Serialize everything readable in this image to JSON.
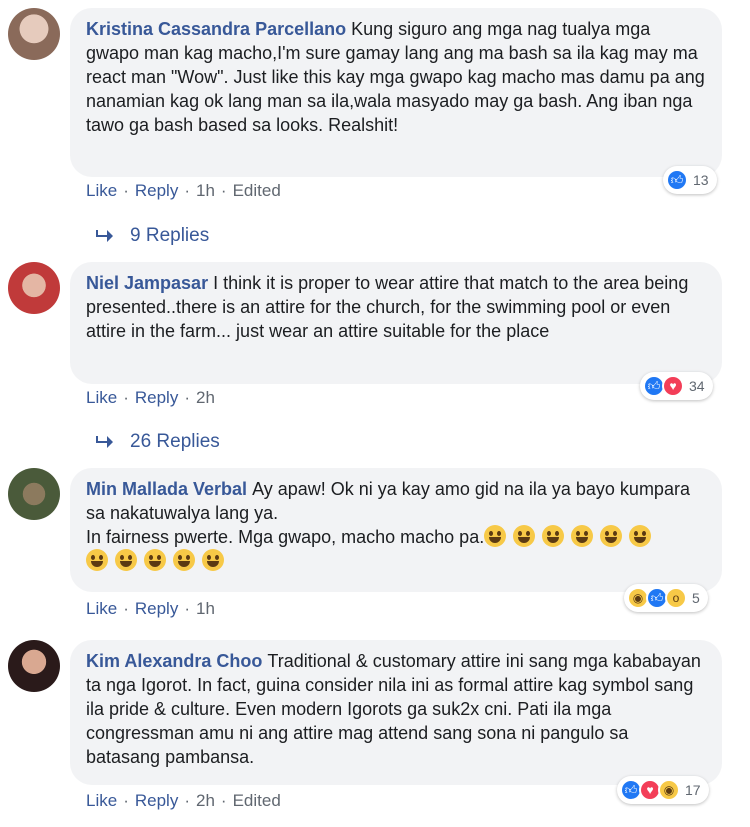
{
  "comments": [
    {
      "author": "Kristina Cassandra Parcellano",
      "text": "Kung siguro ang mga nag tualya mga gwapo man kag macho,I'm sure gamay lang ang ma bash sa ila kag may ma react man \"Wow\". Just like this kay mga gwapo kag macho mas damu pa ang nanamian kag ok lang man sa ila,wala masyado may ga bash. Ang iban nga tawo ga bash based sa looks. Realshit!",
      "like": "Like",
      "reply": "Reply",
      "time": "1h",
      "edited": "Edited",
      "reaction_count": "13",
      "replies": "9 Replies",
      "avatar_color": "#c8a89c"
    },
    {
      "author": "Niel Jampasar",
      "text": "I think it is proper to wear attire that match to the area being presented..there is an attire for the church, for the swimming pool or even attire in the farm... just wear an attire suitable for the place",
      "like": "Like",
      "reply": "Reply",
      "time": "2h",
      "reaction_count": "34",
      "replies": "26 Replies",
      "avatar_color": "#b43a3a"
    },
    {
      "author": "Min Mallada Verbal",
      "text": "Ay apaw! Ok ni ya kay amo gid na ila ya bayo kumpara sa nakatuwalya lang ya.\nIn fairness pwerte. Mga gwapo, macho macho pa.",
      "like": "Like",
      "reply": "Reply",
      "time": "1h",
      "reaction_count": "5",
      "avatar_color": "#6b5b4b"
    },
    {
      "author": "Kim Alexandra Choo",
      "text": "Traditional & customary attire ini sang mga kababayan ta nga Igorot. In fact, guina consider nila ini as formal attire kag symbol sang ila pride & culture. Even modern Igorots ga suk2x cni. Pati ila mga congressman amu ni ang attire mag attend sang sona ni pangulo sa batasang pambansa.",
      "like": "Like",
      "reply": "Reply",
      "time": "2h",
      "edited": "Edited",
      "reaction_count": "17",
      "avatar_color": "#3a2a2a"
    }
  ],
  "colors": {
    "link": "#385898",
    "meta": "#606770",
    "bubble": "#f2f3f5",
    "like": "#2078f4",
    "love": "#f33e58",
    "emoji": "#f7c947"
  },
  "icons": {
    "reply_arrow": "reply-arrow-icon",
    "like": "like-reaction-icon",
    "love": "love-reaction-icon",
    "haha": "haha-reaction-icon",
    "wow": "wow-reaction-icon"
  }
}
